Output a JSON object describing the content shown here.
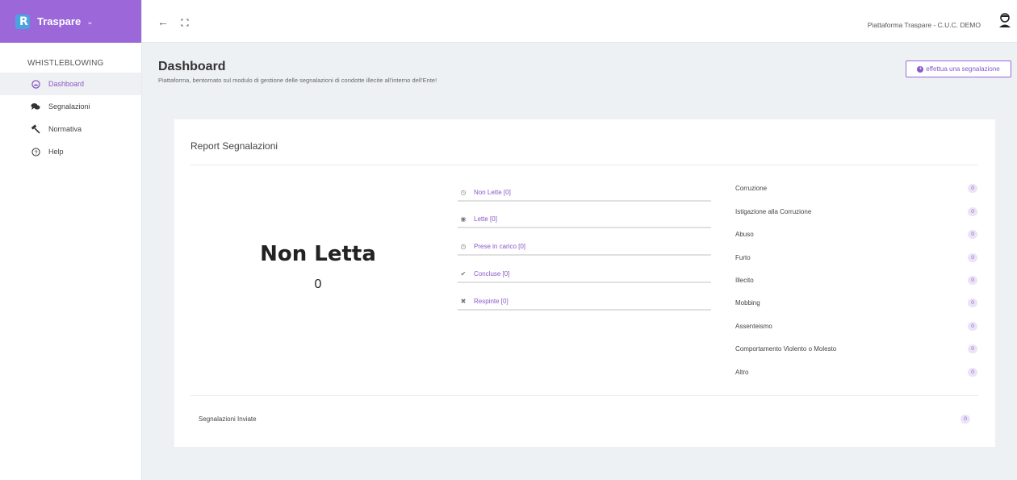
{
  "brand": {
    "name": "Traspare",
    "logo_letter": "R",
    "color": "#9b67d9"
  },
  "sidebar": {
    "section_title": "WHISTLEBLOWING",
    "items": [
      {
        "label": "Dashboard",
        "icon": "dashboard-icon",
        "active": true
      },
      {
        "label": "Segnalazioni",
        "icon": "comments-icon",
        "active": false
      },
      {
        "label": "Normativa",
        "icon": "gavel-icon",
        "active": false
      },
      {
        "label": "Help",
        "icon": "help-icon",
        "active": false
      }
    ]
  },
  "topbar": {
    "user_label": "Piattaforma Traspare - C.U.C. DEMO"
  },
  "page": {
    "title": "Dashboard",
    "subtitle": "Piattaforma, bentornato sul modulo di gestione delle segnalazioni di condotte illecite all'interno dell'Ente!",
    "action_label": "effettua una segnalazione"
  },
  "report": {
    "title": "Report Segnalazioni",
    "highlight_label": "Non Letta",
    "highlight_value": "0",
    "statuses": [
      {
        "label": "Non Lette [0]",
        "icon": "clock-icon"
      },
      {
        "label": "Lette [0]",
        "icon": "eye-icon"
      },
      {
        "label": "Prese in carico [0]",
        "icon": "clock-icon"
      },
      {
        "label": "Concluse [0]",
        "icon": "check-icon"
      },
      {
        "label": "Respinte [0]",
        "icon": "times-icon"
      }
    ],
    "categories": [
      {
        "name": "Corruzione",
        "count": "0"
      },
      {
        "name": "Istigazione alla Corruzione",
        "count": "0"
      },
      {
        "name": "Abuso",
        "count": "0"
      },
      {
        "name": "Furto",
        "count": "0"
      },
      {
        "name": "Illecito",
        "count": "0"
      },
      {
        "name": "Mobbing",
        "count": "0"
      },
      {
        "name": "Assenteismo",
        "count": "0"
      },
      {
        "name": "Comportamento Violento o Molesto",
        "count": "0"
      },
      {
        "name": "Altro",
        "count": "0"
      }
    ],
    "sent_label": "Segnalazioni Inviate",
    "sent_count": "0"
  }
}
